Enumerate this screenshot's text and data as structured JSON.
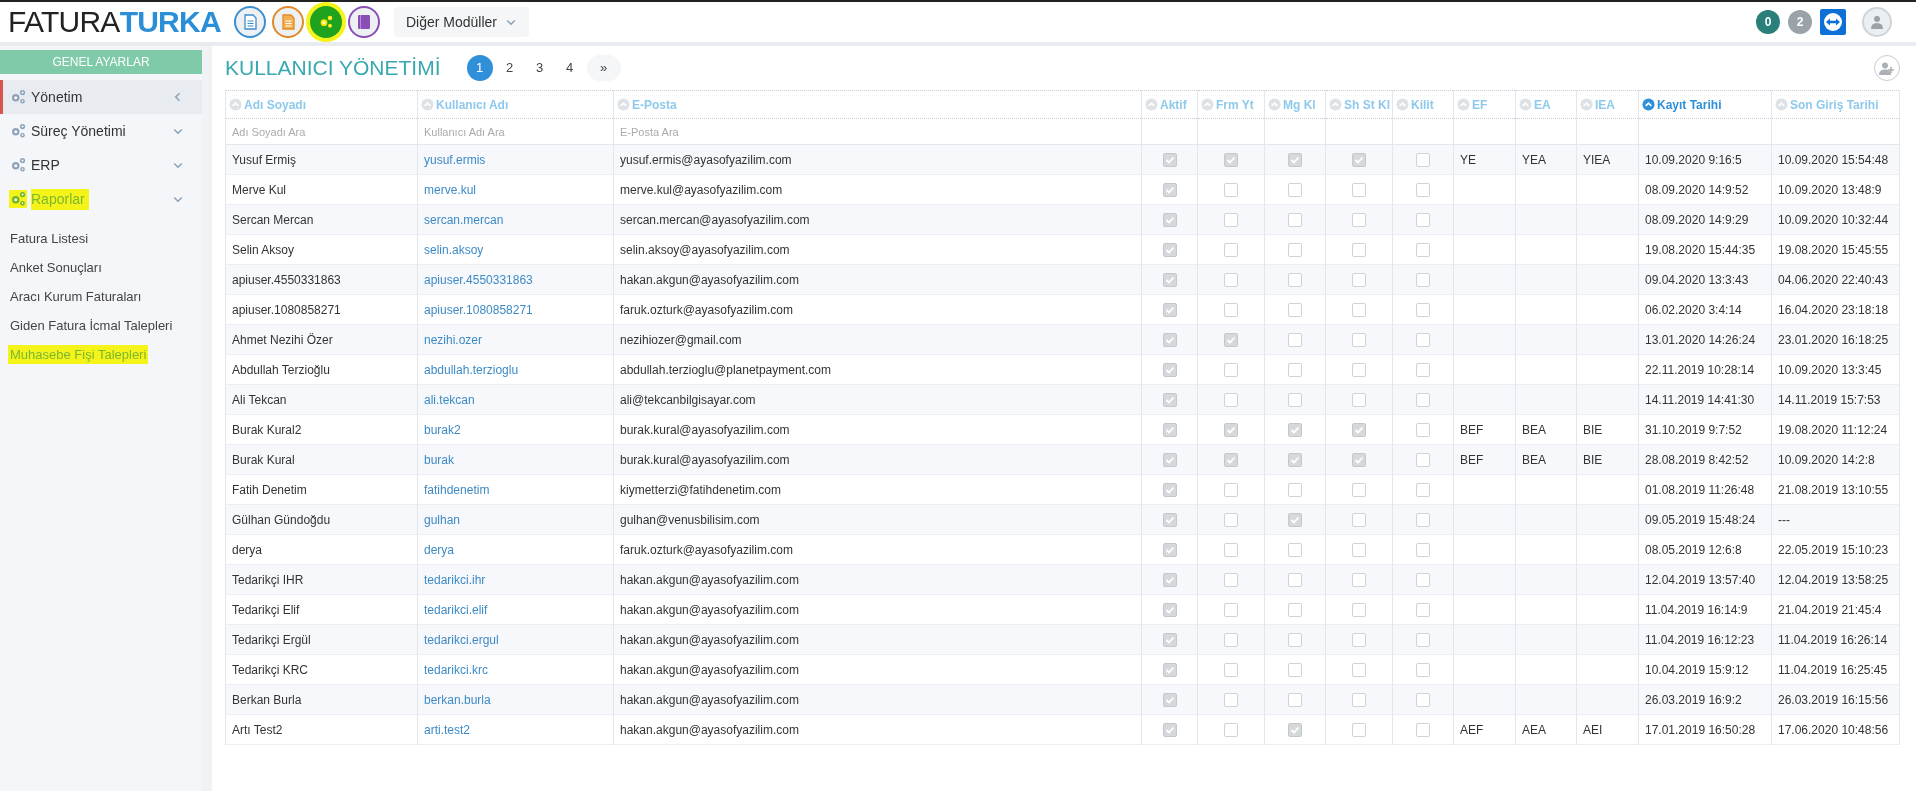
{
  "logo": {
    "part_1": "FATURA",
    "part_2": "TURKA"
  },
  "modules": [
    {
      "color": "#3a8fd0",
      "selected": false,
      "highlighted": false
    },
    {
      "color": "#e08a2a",
      "selected": false,
      "highlighted": false
    },
    {
      "color": "#1fa31f",
      "selected": true,
      "highlighted": true
    },
    {
      "color": "#8a4fb5",
      "selected": false,
      "highlighted": false
    }
  ],
  "other_modules": "Diğer Modüller",
  "badges": [
    {
      "label": "0",
      "color": "#2a7f7a"
    },
    {
      "label": "2",
      "color": "#9aa3a8"
    }
  ],
  "sidebar": {
    "title": "GENEL AYARLAR",
    "items": [
      {
        "label": "Yönetim",
        "selected": true,
        "highlighted": false
      },
      {
        "label": "Süreç Yönetimi",
        "selected": false,
        "highlighted": false
      },
      {
        "label": "ERP",
        "selected": false,
        "highlighted": false
      },
      {
        "label": "Raporlar",
        "selected": false,
        "highlighted": true,
        "children": [
          {
            "label": "Fatura Listesi",
            "highlighted": false
          },
          {
            "label": "Anket Sonuçları",
            "highlighted": false
          },
          {
            "label": "Aracı Kurum Faturaları",
            "highlighted": false
          },
          {
            "label": "Giden Fatura İcmal Talepleri",
            "highlighted": false
          },
          {
            "label": "Muhasebe Fişi Talepleri",
            "highlighted": true
          }
        ]
      }
    ]
  },
  "page_title": "KULLANICI YÖNETİMİ",
  "pagination": [
    {
      "label": "1",
      "selected": true
    },
    {
      "label": "2",
      "selected": false
    },
    {
      "label": "3",
      "selected": false
    },
    {
      "label": "4",
      "selected": false
    },
    {
      "label": "»",
      "selected": false
    }
  ],
  "table": {
    "columns": [
      {
        "label": "Adı Soyadı",
        "sorted": false,
        "placeholder": "Adı Soyadı Ara"
      },
      {
        "label": "Kullanıcı Adı",
        "sorted": false,
        "placeholder": "Kullanıcı Adı Ara"
      },
      {
        "label": "E-Posta",
        "sorted": false,
        "placeholder": "E-Posta Ara"
      },
      {
        "label": "Aktif",
        "sorted": false
      },
      {
        "label": "Frm Yt",
        "sorted": false
      },
      {
        "label": "Mg Kl",
        "sorted": false
      },
      {
        "label": "Sh St Kl",
        "sorted": false
      },
      {
        "label": "Kilit",
        "sorted": false
      },
      {
        "label": "EF",
        "sorted": false
      },
      {
        "label": "EA",
        "sorted": false
      },
      {
        "label": "IEA",
        "sorted": false
      },
      {
        "label": "Kayıt Tarihi",
        "sorted": true
      },
      {
        "label": "Son Giriş Tarihi",
        "sorted": false
      }
    ],
    "rows": [
      {
        "name": "Yusuf Ermiş",
        "username": "yusuf.ermis",
        "email": "yusuf.ermis@ayasofyazilim.com",
        "checks": [
          true,
          true,
          true,
          true,
          false
        ],
        "ef": "YE",
        "ea": "YEA",
        "iea": "YIEA",
        "created": "10.09.2020 9:16:5",
        "last_login": "10.09.2020 15:54:48"
      },
      {
        "name": "Merve Kul",
        "username": "merve.kul",
        "email": "merve.kul@ayasofyazilim.com",
        "checks": [
          true,
          false,
          false,
          false,
          false
        ],
        "created": "08.09.2020 14:9:52",
        "last_login": "10.09.2020 13:48:9"
      },
      {
        "name": "Sercan Mercan",
        "username": "sercan.mercan",
        "email": "sercan.mercan@ayasofyazilim.com",
        "checks": [
          true,
          false,
          false,
          false,
          false
        ],
        "created": "08.09.2020 14:9:29",
        "last_login": "10.09.2020 10:32:44"
      },
      {
        "name": "Selin Aksoy",
        "username": "selin.aksoy",
        "email": "selin.aksoy@ayasofyazilim.com",
        "checks": [
          true,
          false,
          false,
          false,
          false
        ],
        "created": "19.08.2020 15:44:35",
        "last_login": "19.08.2020 15:45:55"
      },
      {
        "name": "apiuser.4550331863",
        "username": "apiuser.4550331863",
        "email": "hakan.akgun@ayasofyazilim.com",
        "checks": [
          true,
          false,
          false,
          false,
          false
        ],
        "created": "09.04.2020 13:3:43",
        "last_login": "04.06.2020 22:40:43"
      },
      {
        "name": "apiuser.1080858271",
        "username": "apiuser.1080858271",
        "email": "faruk.ozturk@ayasofyazilim.com",
        "checks": [
          true,
          false,
          false,
          false,
          false
        ],
        "created": "06.02.2020 3:4:14",
        "last_login": "16.04.2020 23:18:18"
      },
      {
        "name": "Ahmet Nezihi Özer",
        "username": "nezihi.ozer",
        "email": "nezihiozer@gmail.com",
        "checks": [
          true,
          true,
          false,
          false,
          false
        ],
        "created": "13.01.2020 14:26:24",
        "last_login": "23.01.2020 16:18:25"
      },
      {
        "name": "Abdullah Terzioğlu",
        "username": "abdullah.terzioglu",
        "email": "abdullah.terzioglu@planetpayment.com",
        "checks": [
          true,
          false,
          false,
          false,
          false
        ],
        "created": "22.11.2019 10:28:14",
        "last_login": "10.09.2020 13:3:45"
      },
      {
        "name": "Ali Tekcan",
        "username": "ali.tekcan",
        "email": "ali@tekcanbilgisayar.com",
        "checks": [
          true,
          false,
          false,
          false,
          false
        ],
        "created": "14.11.2019 14:41:30",
        "last_login": "14.11.2019 15:7:53"
      },
      {
        "name": "Burak Kural2",
        "username": "burak2",
        "email": "burak.kural@ayasofyazilim.com",
        "checks": [
          true,
          true,
          true,
          true,
          false
        ],
        "ef": "BEF",
        "ea": "BEA",
        "iea": "BIE",
        "created": "31.10.2019 9:7:52",
        "last_login": "19.08.2020 11:12:24"
      },
      {
        "name": "Burak Kural",
        "username": "burak",
        "email": "burak.kural@ayasofyazilim.com",
        "checks": [
          true,
          true,
          true,
          true,
          false
        ],
        "ef": "BEF",
        "ea": "BEA",
        "iea": "BIE",
        "created": "28.08.2019 8:42:52",
        "last_login": "10.09.2020 14:2:8"
      },
      {
        "name": "Fatih Denetim",
        "username": "fatihdenetim",
        "email": "kiymetterzi@fatihdenetim.com",
        "checks": [
          true,
          false,
          false,
          false,
          false
        ],
        "created": "01.08.2019 11:26:48",
        "last_login": "21.08.2019 13:10:55"
      },
      {
        "name": "Gülhan Gündoğdu",
        "username": "gulhan",
        "email": "gulhan@venusbilisim.com",
        "checks": [
          true,
          false,
          true,
          false,
          false
        ],
        "created": "09.05.2019 15:48:24",
        "last_login": "---"
      },
      {
        "name": "derya",
        "username": "derya",
        "email": "faruk.ozturk@ayasofyazilim.com",
        "checks": [
          true,
          false,
          false,
          false,
          false
        ],
        "created": "08.05.2019 12:6:8",
        "last_login": "22.05.2019 15:10:23"
      },
      {
        "name": "Tedarikçi IHR",
        "username": "tedarikci.ihr",
        "email": "hakan.akgun@ayasofyazilim.com",
        "checks": [
          true,
          false,
          false,
          false,
          false
        ],
        "created": "12.04.2019 13:57:40",
        "last_login": "12.04.2019 13:58:25"
      },
      {
        "name": "Tedarikçi Elif",
        "username": "tedarikci.elif",
        "email": "hakan.akgun@ayasofyazilim.com",
        "checks": [
          true,
          false,
          false,
          false,
          false
        ],
        "created": "11.04.2019 16:14:9",
        "last_login": "21.04.2019 21:45:4"
      },
      {
        "name": "Tedarikçi Ergül",
        "username": "tedarikci.ergul",
        "email": "hakan.akgun@ayasofyazilim.com",
        "checks": [
          true,
          false,
          false,
          false,
          false
        ],
        "created": "11.04.2019 16:12:23",
        "last_login": "11.04.2019 16:26:14"
      },
      {
        "name": "Tedarikçi KRC",
        "username": "tedarikci.krc",
        "email": "hakan.akgun@ayasofyazilim.com",
        "checks": [
          true,
          false,
          false,
          false,
          false
        ],
        "created": "10.04.2019 15:9:12",
        "last_login": "11.04.2019 16:25:45"
      },
      {
        "name": "Berkan Burla",
        "username": "berkan.burla",
        "email": "hakan.akgun@ayasofyazilim.com",
        "checks": [
          true,
          false,
          false,
          false,
          false
        ],
        "created": "26.03.2019 16:9:2",
        "last_login": "26.03.2019 16:15:56"
      },
      {
        "name": "Artı Test2",
        "username": "arti.test2",
        "email": "hakan.akgun@ayasofyazilim.com",
        "checks": [
          true,
          false,
          true,
          false,
          false
        ],
        "ef": "AEF",
        "ea": "AEA",
        "iea": "AEI",
        "created": "17.01.2019 16:50:28",
        "last_login": "17.06.2020 10:48:56"
      }
    ]
  }
}
